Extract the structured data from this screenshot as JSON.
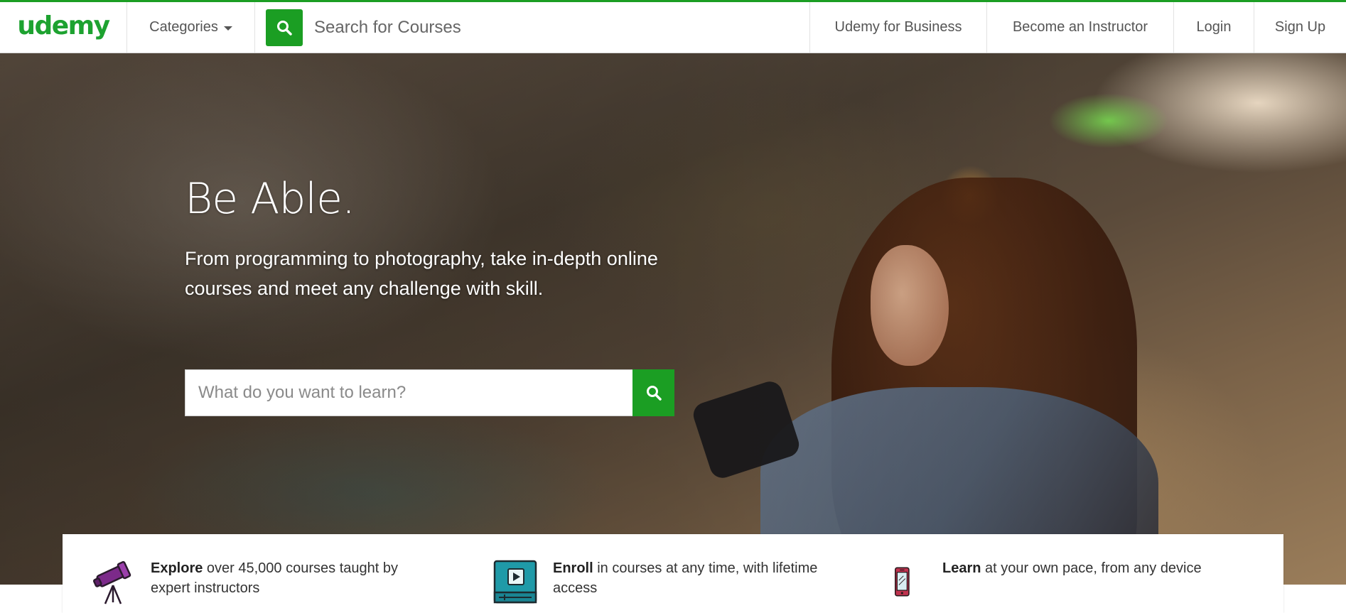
{
  "header": {
    "logo": "udemy",
    "categories_label": "Categories",
    "search_placeholder": "Search for Courses",
    "nav": {
      "business": "Udemy for Business",
      "instructor": "Become an Instructor",
      "login": "Login",
      "signup": "Sign Up"
    }
  },
  "hero": {
    "title": "Be Able.",
    "subtitle": "From programming to photography, take in-depth online courses and meet any challenge with skill.",
    "search_placeholder": "What do you want to learn?"
  },
  "features": [
    {
      "icon": "telescope-icon",
      "bold": "Explore",
      "text": " over 45,000 courses taught by expert instructors"
    },
    {
      "icon": "play-video-icon",
      "bold": "Enroll",
      "text": " in courses at any time, with lifetime access"
    },
    {
      "icon": "mobile-device-icon",
      "bold": "Learn",
      "text": " at your own pace, from any device"
    }
  ],
  "colors": {
    "brand_green": "#1b9e23",
    "telescope_purple": "#7c2a8a",
    "video_teal": "#1f9aa8",
    "phone_red": "#c0334f"
  }
}
